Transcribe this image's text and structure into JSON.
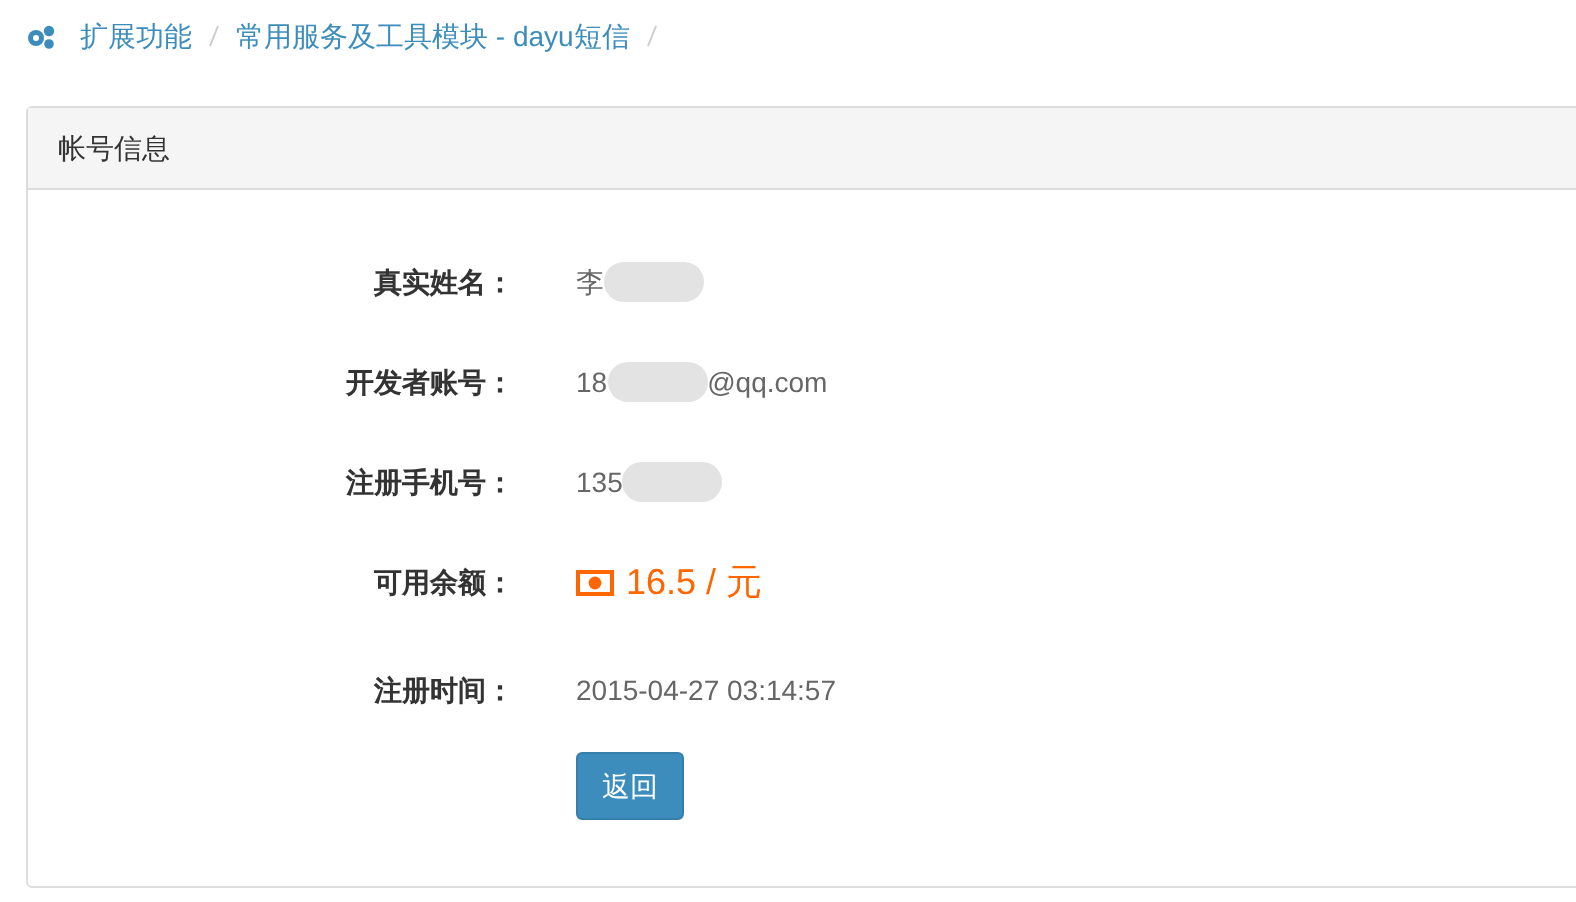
{
  "breadcrumb": [
    {
      "label": "扩展功能"
    },
    {
      "label": "常用服务及工具模块 - dayu短信"
    }
  ],
  "panel": {
    "title": "帐号信息",
    "fields": [
      {
        "kind": "text",
        "label": "真实姓名：",
        "prefix": "李",
        "redacted": true
      },
      {
        "kind": "text",
        "label": "开发者账号：",
        "prefix": "18",
        "suffix": "@qq.com",
        "redacted": true
      },
      {
        "kind": "text",
        "label": "注册手机号：",
        "prefix": "135",
        "redacted": true
      },
      {
        "kind": "money",
        "label": "可用余额：",
        "prefix": "16.5 / 元"
      },
      {
        "kind": "text",
        "label": "注册时间：",
        "prefix": "2015-04-27 03:14:57"
      }
    ],
    "button": "返回"
  }
}
